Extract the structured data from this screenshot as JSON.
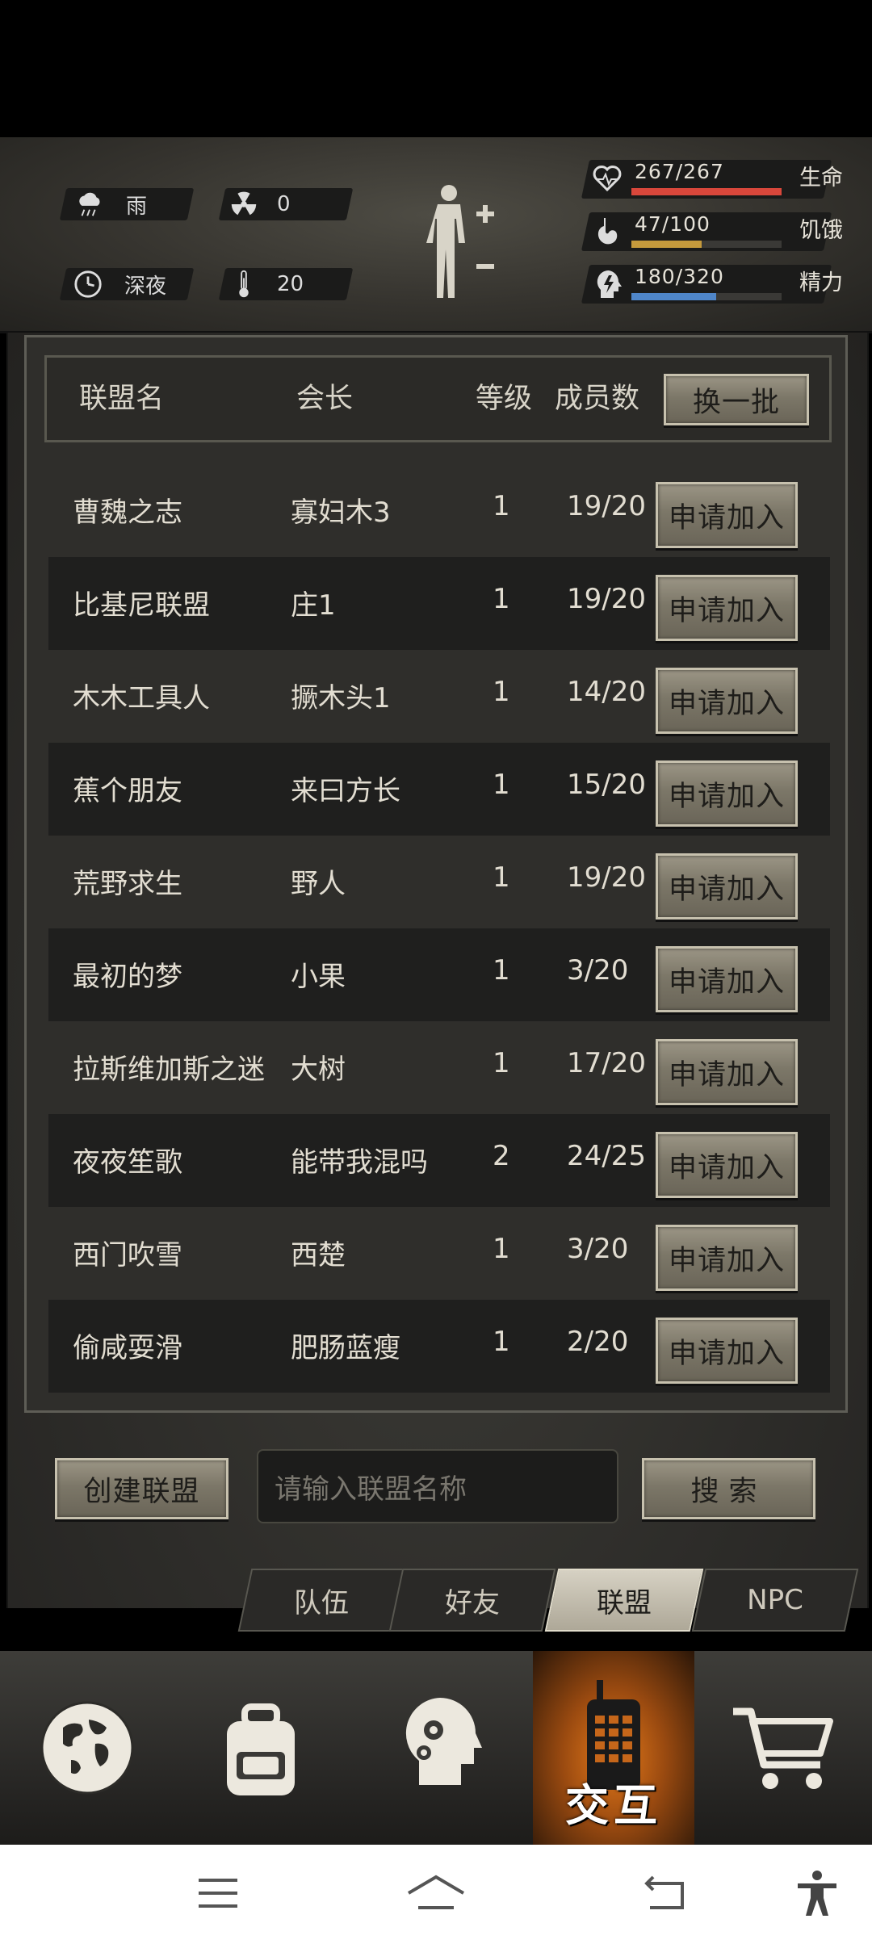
{
  "status": {
    "weather": "雨",
    "radiation": "0",
    "time_of_day": "深夜",
    "temperature": "20",
    "health": {
      "text": "267/267",
      "label": "生命",
      "fraction": 1.0,
      "color": "#d9473b"
    },
    "hunger": {
      "text": "47/100",
      "label": "饥饿",
      "fraction": 0.47,
      "color": "#c59a3c"
    },
    "energy": {
      "text": "180/320",
      "label": "精力",
      "fraction": 0.5625,
      "color": "#4f86c9"
    }
  },
  "table": {
    "headers": {
      "name": "联盟名",
      "leader": "会长",
      "level": "等级",
      "members": "成员数"
    },
    "refresh_label": "换一批",
    "rows": [
      {
        "name": "曹魏之志",
        "leader": "寡妇木3",
        "level": "1",
        "members": "19/20",
        "action": "申请加入"
      },
      {
        "name": "比基尼联盟",
        "leader": "庄1",
        "level": "1",
        "members": "19/20",
        "action": "申请加入"
      },
      {
        "name": "木木工具人",
        "leader": "撅木头1",
        "level": "1",
        "members": "14/20",
        "action": "申请加入"
      },
      {
        "name": "蕉个朋友",
        "leader": "来曰方长",
        "level": "1",
        "members": "15/20",
        "action": "申请加入"
      },
      {
        "name": "荒野求生",
        "leader": "野人",
        "level": "1",
        "members": "19/20",
        "action": "申请加入"
      },
      {
        "name": "最初的梦",
        "leader": "小果",
        "level": "1",
        "members": "3/20",
        "action": "申请加入"
      },
      {
        "name": "拉斯维加斯之迷",
        "leader": "大树",
        "level": "1",
        "members": "17/20",
        "action": "申请加入"
      },
      {
        "name": "夜夜笙歌",
        "leader": "能带我混吗",
        "level": "2",
        "members": "24/25",
        "action": "申请加入"
      },
      {
        "name": "西门吹雪",
        "leader": "西楚",
        "level": "1",
        "members": "3/20",
        "action": "申请加入"
      },
      {
        "name": "偷咸耍滑",
        "leader": "肥肠蓝瘦",
        "level": "1",
        "members": "2/20",
        "action": "申请加入"
      }
    ]
  },
  "controls": {
    "create_label": "创建联盟",
    "search_placeholder": "请输入联盟名称",
    "search_label": "搜索"
  },
  "tabs": [
    {
      "label": "队伍",
      "active": false
    },
    {
      "label": "好友",
      "active": false
    },
    {
      "label": "联盟",
      "active": true
    },
    {
      "label": "NPC",
      "active": false
    }
  ],
  "nav": {
    "interact_label": "交互",
    "icons": [
      "globe-icon",
      "backpack-icon",
      "skills-head-icon",
      "walkie-talkie-icon",
      "cart-icon"
    ]
  }
}
